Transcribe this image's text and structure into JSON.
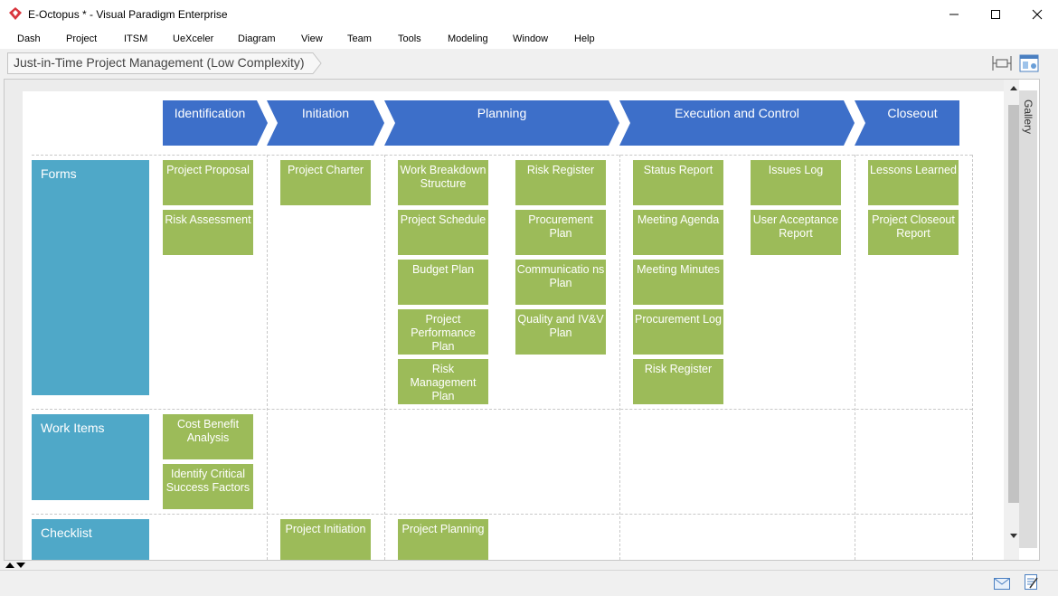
{
  "window": {
    "title": "E-Octopus * - Visual Paradigm Enterprise",
    "controls": [
      "minimize",
      "maximize",
      "close"
    ]
  },
  "menubar": {
    "items": [
      "Dash",
      "Project",
      "ITSM",
      "UeXceler",
      "Diagram",
      "View",
      "Team",
      "Tools",
      "Modeling",
      "Window",
      "Help"
    ]
  },
  "breadcrumb": {
    "label": "Just-in-Time Project Management (Low Complexity)"
  },
  "phases": [
    "Identification",
    "Initiation",
    "Planning",
    "Execution and Control",
    "Closeout"
  ],
  "rows": {
    "forms": "Forms",
    "work_items": "Work Items",
    "checklist": "Checklist"
  },
  "cards": {
    "project_proposal": "Project Proposal",
    "risk_assessment": "Risk Assessment",
    "project_charter": "Project Charter",
    "wbs": "Work Breakdown Structure",
    "project_schedule": "Project Schedule",
    "budget_plan": "Budget Plan",
    "project_performance_plan": "Project Performance Plan",
    "risk_management_plan": "Risk Management Plan",
    "risk_register_planning": "Risk Register",
    "procurement_plan": "Procurement Plan",
    "communications_plan": "Communicatio ns Plan",
    "quality_ivv_plan": "Quality and IV&V Plan",
    "status_report": "Status Report",
    "meeting_agenda": "Meeting Agenda",
    "meeting_minutes": "Meeting Minutes",
    "procurement_log": "Procurement Log",
    "risk_register_exec": "Risk Register",
    "issues_log": "Issues Log",
    "user_acceptance_report": "User Acceptance Report",
    "lessons_learned": "Lessons Learned",
    "project_closeout_report": "Project Closeout Report",
    "cost_benefit_analysis": "Cost Benefit Analysis",
    "identify_csf": "Identify Critical Success Factors",
    "project_initiation": "Project Initiation",
    "project_planning": "Project Planning"
  },
  "gallery": {
    "label": "Gallery"
  },
  "colors": {
    "phase": "#3d6fc9",
    "row_header": "#4fa8c8",
    "card": "#9cbb59"
  },
  "icons": [
    "app-logo-icon",
    "fit-diagram-icon",
    "layout-panel-icon",
    "mail-icon",
    "notes-icon",
    "scroll-up-icon",
    "scroll-down-icon"
  ]
}
